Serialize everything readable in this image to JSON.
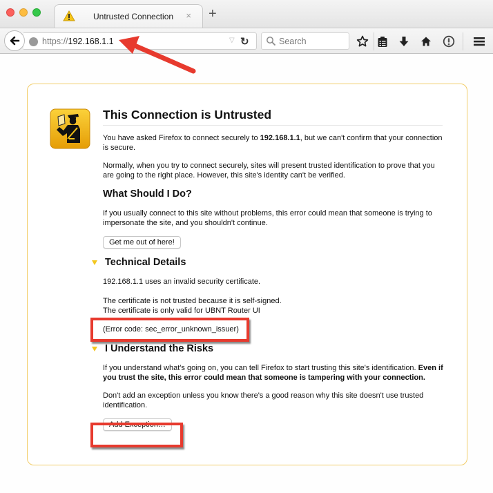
{
  "browser": {
    "tab": {
      "title": "Untrusted Connection",
      "close_glyph": "×",
      "icon": "warning-triangle-icon"
    },
    "new_tab_glyph": "+",
    "url": {
      "scheme": "https://",
      "host": "192.168.1.1"
    },
    "search_placeholder": "Search",
    "toolbar_icons": [
      "bookmark-star-icon",
      "reading-list-icon",
      "download-icon",
      "home-icon",
      "info-icon",
      "menu-icon"
    ]
  },
  "page": {
    "title": "This Connection is Untrusted",
    "intro": {
      "before": "You have asked Firefox to connect securely to ",
      "host": "192.168.1.1",
      "after": ", but we can't confirm that your connection is secure."
    },
    "normally": "Normally, when you try to connect securely, sites will present trusted identification to prove that you are going to the right place. However, this site's identity can't be verified.",
    "what_heading": "What Should I Do?",
    "what_text": "If you usually connect to this site without problems, this error could mean that someone is trying to impersonate the site, and you shouldn't continue.",
    "get_out_button": "Get me out of here!",
    "technical": {
      "heading": "Technical Details",
      "line1": "192.168.1.1 uses an invalid security certificate.",
      "line2": "The certificate is not trusted because it is self-signed.",
      "line3": "The certificate is only valid for UBNT Router UI",
      "error_code": "(Error code: sec_error_unknown_issuer)"
    },
    "risks": {
      "heading": "I Understand the Risks",
      "text1": "If you understand what's going on, you can tell Firefox to start trusting this site's identification.",
      "text1_bold": "Even if you trust the site, this error could mean that someone is tampering with your connection.",
      "text2": "Don't add an exception unless you know there's a good reason why this site doesn't use trusted identification.",
      "add_exception_button": "Add Exception…"
    }
  },
  "annotations": {
    "highlight_color": "#e73a2e",
    "card_border_color": "#f2cd69",
    "toggle_color": "#f3c720"
  }
}
